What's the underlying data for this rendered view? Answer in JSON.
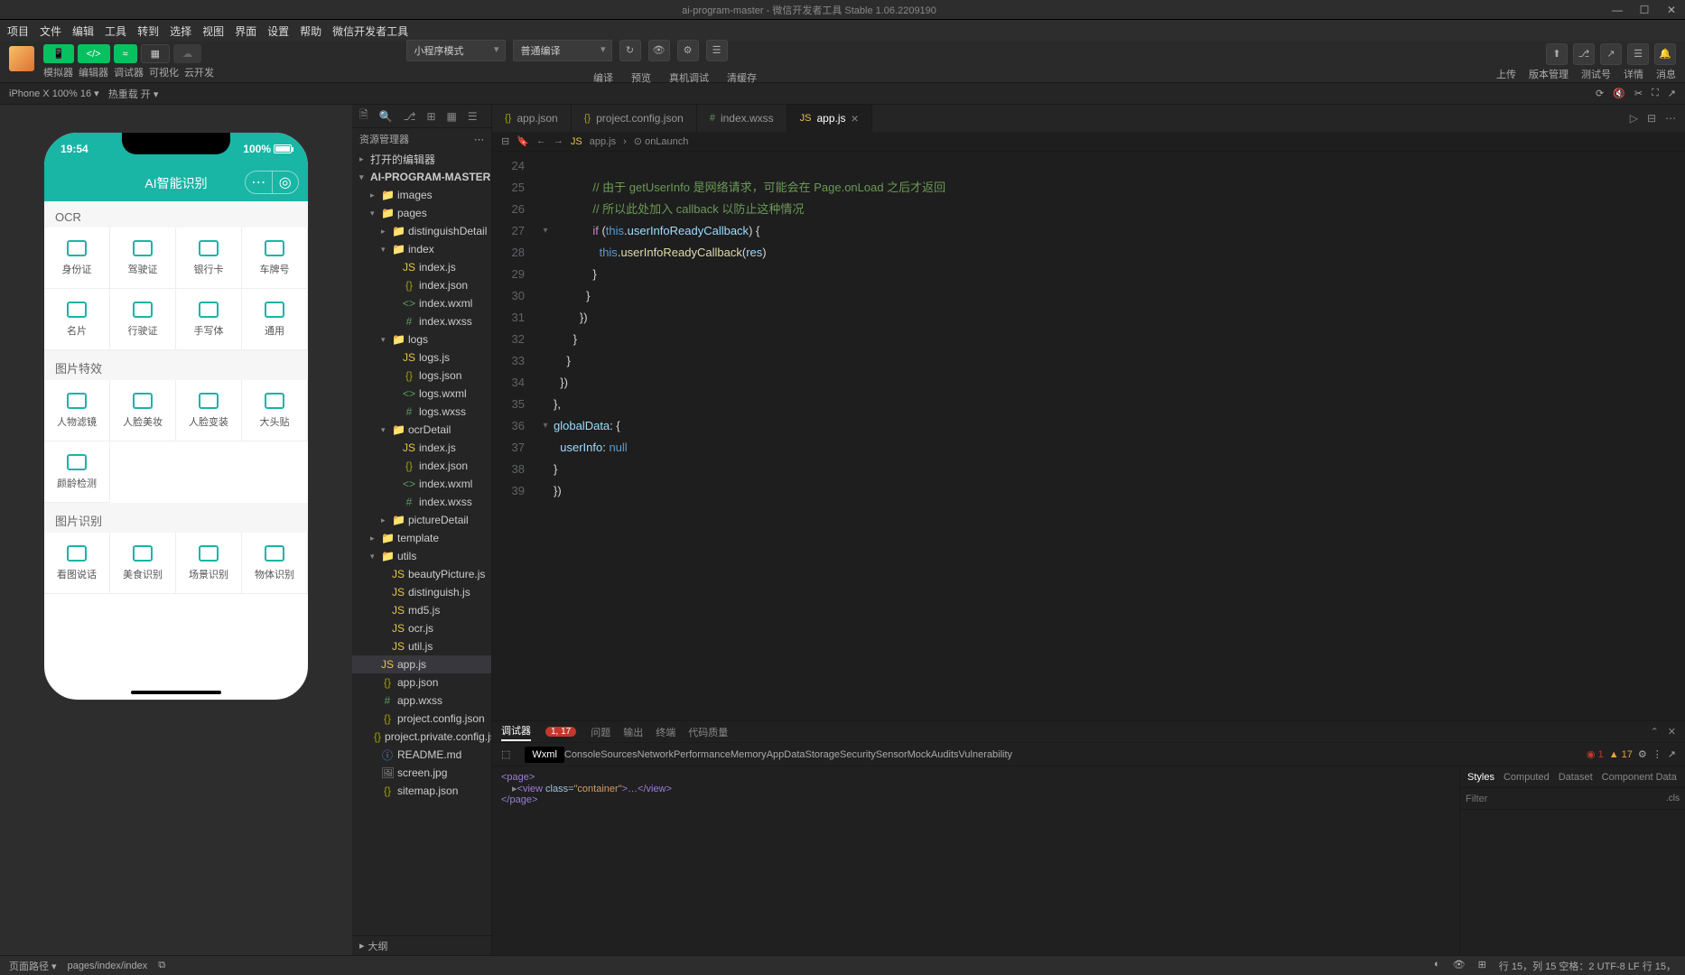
{
  "titlebar": {
    "title": "ai-program-master - 微信开发者工具 Stable 1.06.2209190"
  },
  "menu": [
    "项目",
    "文件",
    "编辑",
    "工具",
    "转到",
    "选择",
    "视图",
    "界面",
    "设置",
    "帮助",
    "微信开发者工具"
  ],
  "toolbar": {
    "mode_labels": [
      "模拟器",
      "编辑器",
      "调试器",
      "可视化",
      "云开发"
    ],
    "run_mode": "小程序模式",
    "compile_mode": "普通编译",
    "mid_labels": [
      "编译",
      "预览",
      "真机调试",
      "清缓存"
    ],
    "right_labels": [
      "上传",
      "版本管理",
      "测试号",
      "详情",
      "消息"
    ]
  },
  "devicebar": {
    "device": "iPhone X 100% 16 ▾",
    "hot": "热重载 开 ▾"
  },
  "phone": {
    "time": "19:54",
    "battery": "100%",
    "title": "AI智能识别",
    "sec1": "OCR",
    "row1": [
      "身份证",
      "驾驶证",
      "银行卡",
      "车牌号"
    ],
    "row2": [
      "名片",
      "行驶证",
      "手写体",
      "通用"
    ],
    "sec2": "图片特效",
    "row3": [
      "人物滤镜",
      "人脸美妆",
      "人脸变装",
      "大头贴"
    ],
    "row4": [
      "颜龄检测"
    ],
    "sec3": "图片识别",
    "row5": [
      "看图说话",
      "美食识别",
      "场景识别",
      "物体识别"
    ]
  },
  "explorer": {
    "title": "资源管理器",
    "section1": "打开的编辑器",
    "root": "AI-PROGRAM-MASTER",
    "tree": [
      {
        "d": 1,
        "t": "folder",
        "n": "images",
        "c": "▸"
      },
      {
        "d": 1,
        "t": "folder",
        "n": "pages",
        "c": "▾"
      },
      {
        "d": 2,
        "t": "folder",
        "n": "distinguishDetail",
        "c": "▸"
      },
      {
        "d": 2,
        "t": "folder",
        "n": "index",
        "c": "▾"
      },
      {
        "d": 3,
        "t": "js",
        "n": "index.js"
      },
      {
        "d": 3,
        "t": "json",
        "n": "index.json"
      },
      {
        "d": 3,
        "t": "wxml",
        "n": "index.wxml"
      },
      {
        "d": 3,
        "t": "wxss",
        "n": "index.wxss"
      },
      {
        "d": 2,
        "t": "folder",
        "n": "logs",
        "c": "▾"
      },
      {
        "d": 3,
        "t": "js",
        "n": "logs.js"
      },
      {
        "d": 3,
        "t": "json",
        "n": "logs.json"
      },
      {
        "d": 3,
        "t": "wxml",
        "n": "logs.wxml"
      },
      {
        "d": 3,
        "t": "wxss",
        "n": "logs.wxss"
      },
      {
        "d": 2,
        "t": "folder",
        "n": "ocrDetail",
        "c": "▾"
      },
      {
        "d": 3,
        "t": "js",
        "n": "index.js"
      },
      {
        "d": 3,
        "t": "json",
        "n": "index.json"
      },
      {
        "d": 3,
        "t": "wxml",
        "n": "index.wxml"
      },
      {
        "d": 3,
        "t": "wxss",
        "n": "index.wxss"
      },
      {
        "d": 2,
        "t": "folder",
        "n": "pictureDetail",
        "c": "▸"
      },
      {
        "d": 1,
        "t": "folder",
        "n": "template",
        "c": "▸"
      },
      {
        "d": 1,
        "t": "folder",
        "n": "utils",
        "c": "▾"
      },
      {
        "d": 2,
        "t": "js",
        "n": "beautyPicture.js"
      },
      {
        "d": 2,
        "t": "js",
        "n": "distinguish.js"
      },
      {
        "d": 2,
        "t": "js",
        "n": "md5.js"
      },
      {
        "d": 2,
        "t": "js",
        "n": "ocr.js"
      },
      {
        "d": 2,
        "t": "js",
        "n": "util.js"
      },
      {
        "d": 1,
        "t": "js",
        "n": "app.js",
        "sel": true
      },
      {
        "d": 1,
        "t": "json",
        "n": "app.json"
      },
      {
        "d": 1,
        "t": "wxss",
        "n": "app.wxss"
      },
      {
        "d": 1,
        "t": "json",
        "n": "project.config.json"
      },
      {
        "d": 1,
        "t": "json",
        "n": "project.private.config.js..."
      },
      {
        "d": 1,
        "t": "md",
        "n": "README.md"
      },
      {
        "d": 1,
        "t": "img",
        "n": "screen.jpg"
      },
      {
        "d": 1,
        "t": "json",
        "n": "sitemap.json"
      }
    ],
    "outline": "大纲"
  },
  "tabs": [
    {
      "icon": "json",
      "label": "app.json"
    },
    {
      "icon": "json",
      "label": "project.config.json"
    },
    {
      "icon": "wxss",
      "label": "index.wxss"
    },
    {
      "icon": "js",
      "label": "app.js",
      "active": true
    }
  ],
  "crumbs": {
    "file": "app.js",
    "symbol": "onLaunch"
  },
  "code": {
    "startLine": 24,
    "lines": [
      {
        "n": 24,
        "html": ""
      },
      {
        "n": 25,
        "html": "            <span class='c-comment'>// 由于 getUserInfo 是网络请求，可能会在 Page.onLoad 之后才返回</span>"
      },
      {
        "n": 26,
        "html": "            <span class='c-comment'>// 所以此处加入 callback 以防止这种情况</span>"
      },
      {
        "n": 27,
        "fold": "▾",
        "html": "            <span class='c-kw'>if</span> (<span class='c-this'>this</span>.<span class='c-prop'>userInfoReadyCallback</span>) {"
      },
      {
        "n": 28,
        "html": "              <span class='c-this'>this</span>.<span class='c-fn'>userInfoReadyCallback</span>(<span class='c-prop'>res</span>)"
      },
      {
        "n": 29,
        "html": "            }"
      },
      {
        "n": 30,
        "html": "          }"
      },
      {
        "n": 31,
        "html": "        })"
      },
      {
        "n": 32,
        "html": "      }"
      },
      {
        "n": 33,
        "html": "    }"
      },
      {
        "n": 34,
        "html": "  })"
      },
      {
        "n": 35,
        "html": "},"
      },
      {
        "n": 36,
        "fold": "▾",
        "html": "<span class='c-prop'>globalData</span>: {"
      },
      {
        "n": 37,
        "html": "  <span class='c-prop'>userInfo</span>: <span class='c-const'>null</span>"
      },
      {
        "n": 38,
        "html": "}"
      },
      {
        "n": 39,
        "html": "})"
      }
    ]
  },
  "devtools": {
    "tabs1_active": "调试器",
    "badge": "1, 17",
    "tabs1": [
      "问题",
      "输出",
      "终端",
      "代码质量"
    ],
    "tabs2": [
      "Wxml",
      "Console",
      "Sources",
      "Network",
      "Performance",
      "Memory",
      "AppData",
      "Storage",
      "Security",
      "Sensor",
      "Mock",
      "Audits",
      "Vulnerability"
    ],
    "err_count": "1",
    "warn_count": "17",
    "dom_l1": "<page>",
    "dom_l2_open": "<view",
    "dom_attr_n": "class=",
    "dom_attr_v": "\"container\"",
    "dom_l2_mid": ">…</view>",
    "dom_l3": "</page>",
    "side_tabs": [
      "Styles",
      "Computed",
      "Dataset",
      "Component Data"
    ],
    "filter_ph": "Filter",
    "cls": ".cls"
  },
  "statusbar": {
    "left1": "页面路径 ▾",
    "left2": "pages/index/index",
    "right": "行 15，列 15  空格：2  UTF-8  LF  行 15，"
  }
}
